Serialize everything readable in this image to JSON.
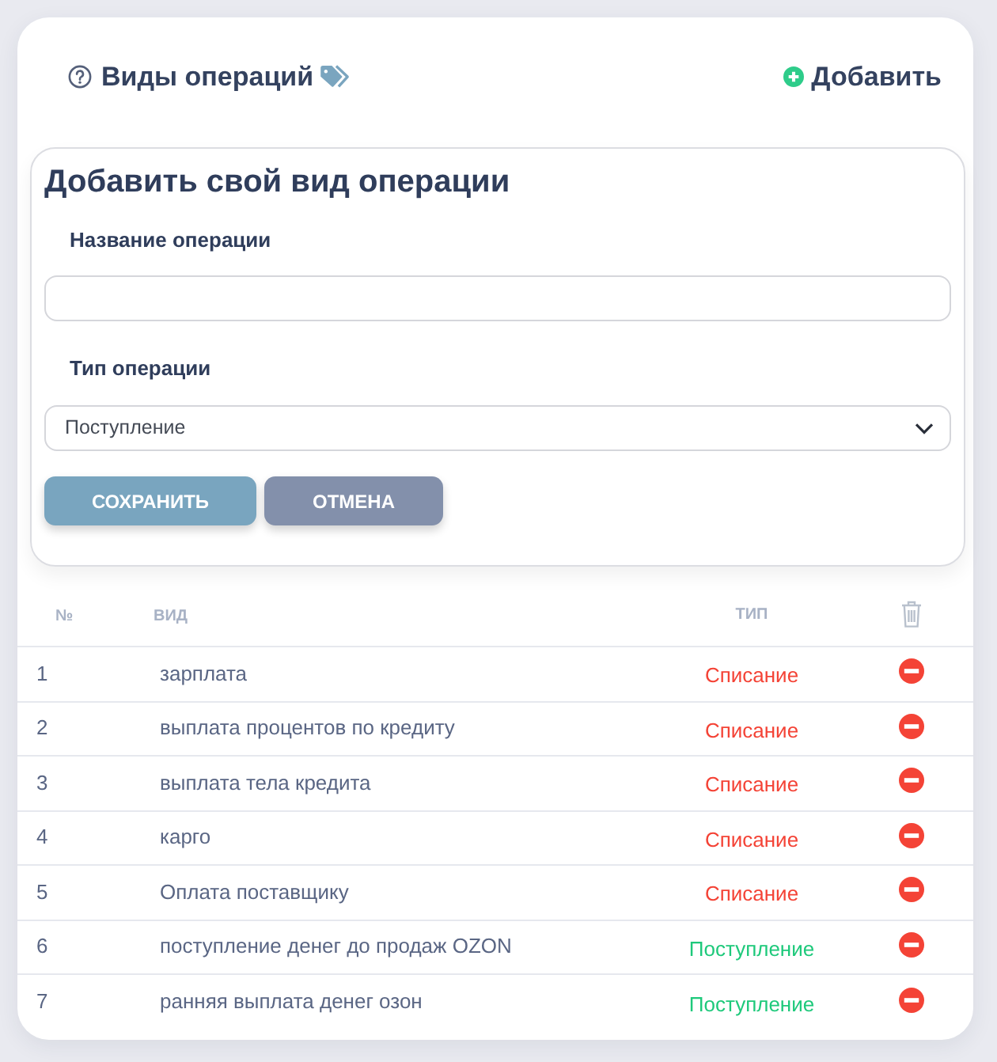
{
  "header": {
    "title": "Виды операций",
    "add_button": "Добавить"
  },
  "form": {
    "title": "Добавить свой вид операции",
    "fields": [
      {
        "kind": "text",
        "label": "Название операции"
      },
      {
        "kind": "select",
        "label": "Тип операции",
        "value": "Поступление"
      }
    ],
    "buttons": [
      {
        "kind": "primary",
        "label": "СОХРАНИТЬ"
      },
      {
        "kind": "secondary",
        "label": "ОТМЕНА"
      }
    ]
  },
  "table": {
    "columns": [
      "№",
      "ВИД",
      "ТИП"
    ],
    "rows": [
      {
        "number": "1",
        "name": "зарплата",
        "type": {
          "label": "Списание",
          "color": "#f44336"
        }
      },
      {
        "number": "2",
        "name": "выплата процентов по кредиту",
        "type": {
          "label": "Списание",
          "color": "#f44336"
        }
      },
      {
        "number": "3",
        "name": "выплата тела кредита",
        "type": {
          "label": "Списание",
          "color": "#f44336"
        }
      },
      {
        "number": "4",
        "name": "карго",
        "type": {
          "label": "Списание",
          "color": "#f44336"
        }
      },
      {
        "number": "5",
        "name": "Оплата поставщику",
        "type": {
          "label": "Списание",
          "color": "#f44336"
        }
      },
      {
        "number": "6",
        "name": "поступление денег до продаж OZON",
        "type": {
          "label": "Поступление",
          "color": "#1ec97b"
        }
      },
      {
        "number": "7",
        "name": "ранняя выплата денег озон",
        "type": {
          "label": "Поступление",
          "color": "#1ec97b"
        }
      }
    ]
  }
}
